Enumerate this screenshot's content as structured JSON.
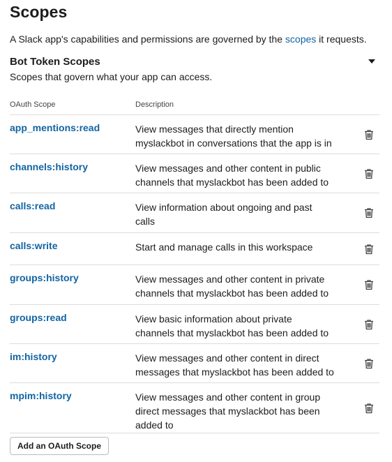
{
  "page": {
    "title": "Scopes",
    "intro_before": "A Slack app's capabilities and permissions are governed by the ",
    "intro_link": "scopes",
    "intro_after": " it requests."
  },
  "section": {
    "title": "Bot Token Scopes",
    "subtitle": "Scopes that govern what your app can access."
  },
  "table": {
    "headers": {
      "scope": "OAuth Scope",
      "description": "Description"
    },
    "rows": [
      {
        "scope": "app_mentions:read",
        "description": [
          "View messages that directly mention",
          "myslackbot in conversations that the app is in"
        ]
      },
      {
        "scope": "channels:history",
        "description": [
          "View messages and other content in public",
          "channels that myslackbot has been added to"
        ]
      },
      {
        "scope": "calls:read",
        "description": [
          "View information about ongoing and past",
          "calls"
        ]
      },
      {
        "scope": "calls:write",
        "description": [
          "Start and manage calls in this workspace"
        ]
      },
      {
        "scope": "groups:history",
        "description": [
          "View messages and other content in private",
          "channels that myslackbot has been added to"
        ]
      },
      {
        "scope": "groups:read",
        "description": [
          "View basic information about private",
          "channels that myslackbot has been added to"
        ]
      },
      {
        "scope": "im:history",
        "description": [
          "View messages and other content in direct",
          "messages that myslackbot has been added to"
        ]
      },
      {
        "scope": "mpim:history",
        "description": [
          "View messages and other content in group",
          "direct messages that myslackbot has been",
          "added to"
        ]
      }
    ]
  },
  "icons": {
    "row_action": "trash-icon",
    "section_toggle": "caret-down-icon"
  },
  "colors": {
    "link": "#1264a3",
    "text": "#1d1c1d",
    "divider": "#dddddd"
  },
  "buttons": {
    "add_scope": "Add an OAuth Scope"
  }
}
